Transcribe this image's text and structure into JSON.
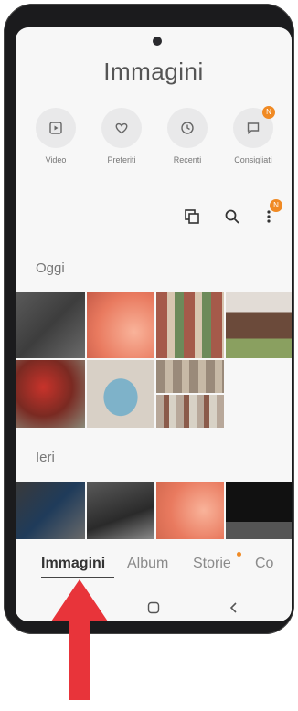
{
  "header": {
    "title": "Immagini"
  },
  "quick_actions": [
    {
      "label": "Video",
      "icon": "video-icon"
    },
    {
      "label": "Preferiti",
      "icon": "heart-icon"
    },
    {
      "label": "Recenti",
      "icon": "clock-icon"
    },
    {
      "label": "Consigliati",
      "icon": "suggestion-icon",
      "badge": "N"
    }
  ],
  "toolbar": {
    "select_icon": "select-icon",
    "search_icon": "search-icon",
    "more_icon": "more-icon",
    "more_badge": "N"
  },
  "sections": {
    "today": "Oggi",
    "yesterday": "Ieri"
  },
  "tabs": [
    {
      "label": "Immagini",
      "active": true
    },
    {
      "label": "Album",
      "active": false
    },
    {
      "label": "Storie",
      "active": false,
      "dot": true
    },
    {
      "label": "Co",
      "active": false
    }
  ],
  "colors": {
    "accent": "#f08a24",
    "arrow": "#e8343a"
  }
}
